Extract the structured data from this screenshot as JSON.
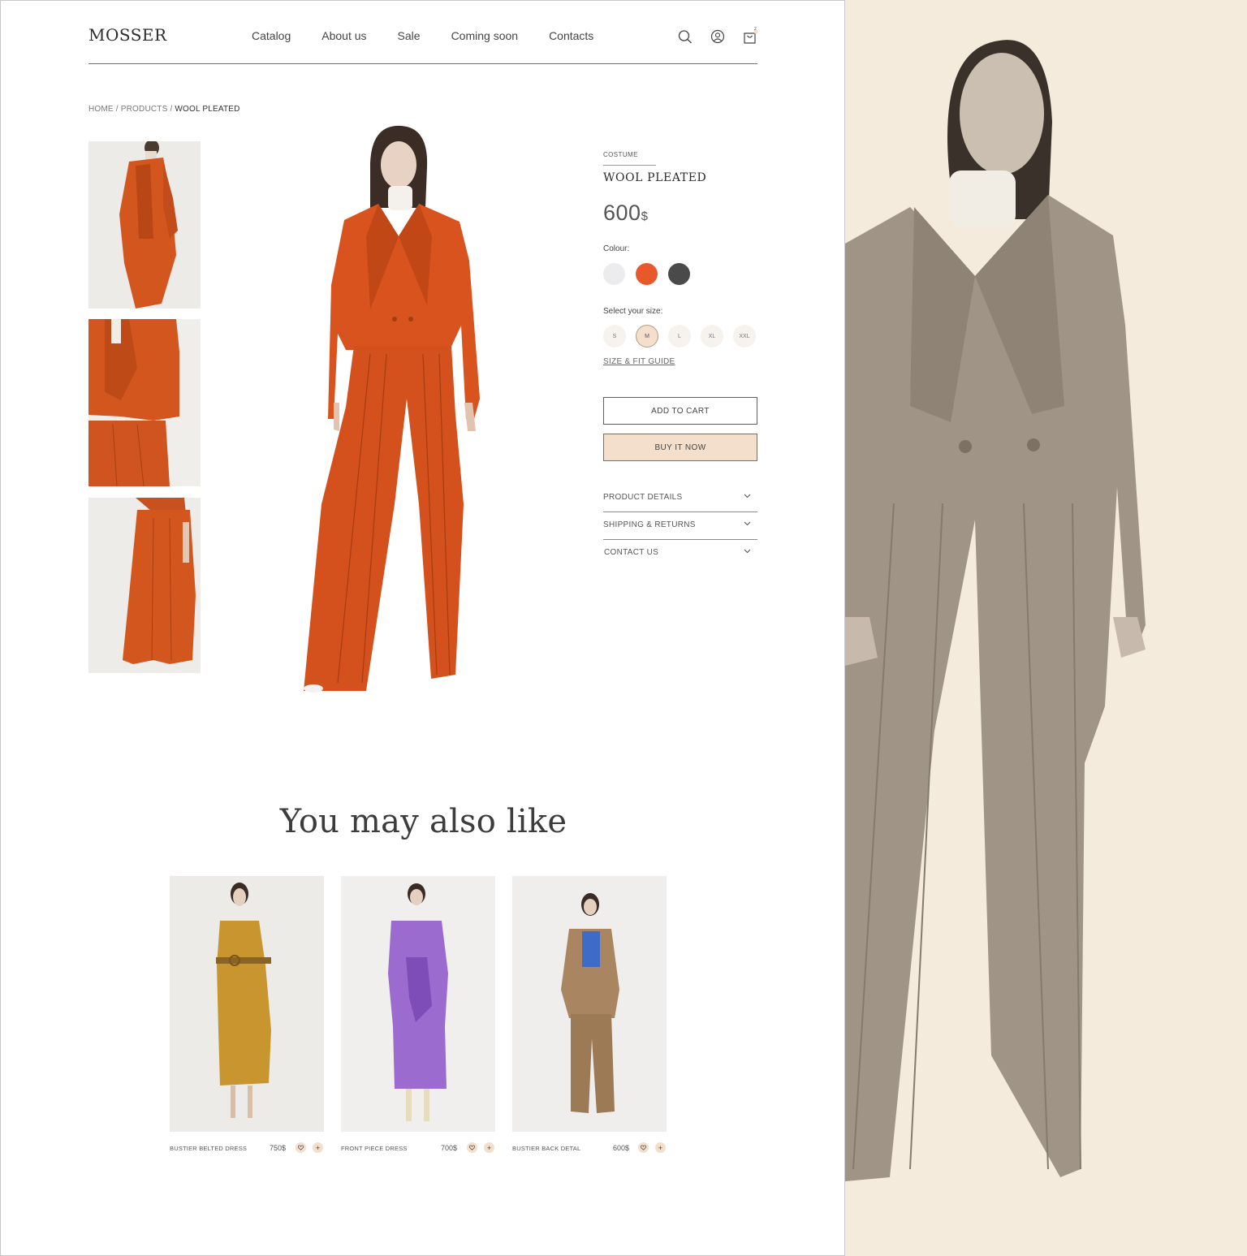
{
  "header": {
    "logo": "MOSSER",
    "nav": [
      "Catalog",
      "About us",
      "Sale",
      "Coming soon",
      "Contacts"
    ],
    "cart_count": "2"
  },
  "breadcrumb": {
    "home": "HOME",
    "sep": " / ",
    "products": "PRODUCTS",
    "current": "WOOL PLEATED"
  },
  "product": {
    "category": "COSTUME",
    "title": "WOOL PLEATED",
    "price": "600",
    "currency": "$",
    "colour_label": "Colour:",
    "colours": [
      "#ececef",
      "#e8582a",
      "#4a4a4a"
    ],
    "size_label": "Select your size:",
    "sizes": [
      "S",
      "M",
      "L",
      "XL",
      "XXL"
    ],
    "selected_size": "M",
    "fit_guide": "SIZE & FIT GUIDE",
    "add_to_cart": "ADD TO CART",
    "buy_now": "BUY IT NOW",
    "accordion": [
      "PRODUCT DETAILS",
      "SHIPPING & RETURNS",
      "CONTACT US"
    ]
  },
  "recommendations": {
    "heading": "You may also like",
    "items": [
      {
        "name": "BUSTIER BELTED DRESS",
        "price": "750$",
        "color": "#c8952e"
      },
      {
        "name": "FRONT PIECE DRESS",
        "price": "700$",
        "color": "#9b6bd0"
      },
      {
        "name": "BUSTIER BACK DETAL",
        "price": "600$",
        "color": "#a98561"
      }
    ]
  },
  "colors": {
    "accent_peach": "#f3dfcc",
    "suit_orange": "#d9531f",
    "side_bg": "#f4ebdd"
  },
  "icons": [
    "search-icon",
    "user-icon",
    "cart-icon",
    "chevron-down-icon",
    "heart-icon",
    "plus-icon"
  ]
}
